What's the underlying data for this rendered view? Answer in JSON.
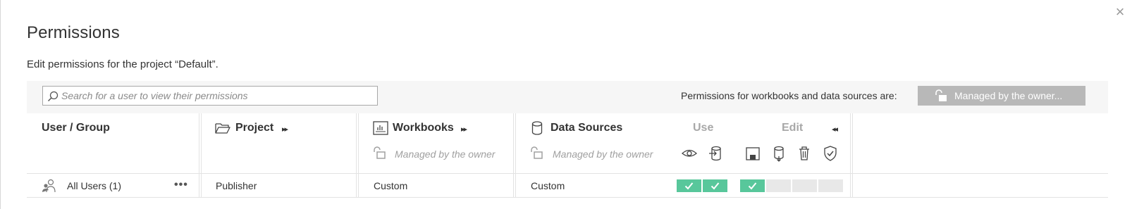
{
  "dialog": {
    "title": "Permissions",
    "subtitle": "Edit permissions for the project “Default”.",
    "close_icon": "×"
  },
  "toolbar": {
    "search_placeholder": "Search for a user to view their permissions",
    "permissions_label": "Permissions for workbooks and data sources are:",
    "managed_button_label": "Managed by the owner..."
  },
  "columns": {
    "user_group": "User / Group",
    "project": "Project",
    "workbooks": "Workbooks",
    "data_sources": "Data Sources",
    "use": "Use",
    "edit": "Edit",
    "managed_note": "Managed by the owner",
    "expand_glyph": "▸▸",
    "collapse_glyph": "◂◂"
  },
  "rows": [
    {
      "user": "All Users (1)",
      "more": "•••",
      "project": "Publisher",
      "workbooks": "Custom",
      "data_sources": "Custom",
      "use_caps": [
        true,
        true
      ],
      "edit_caps": [
        true,
        false,
        false,
        false
      ]
    }
  ],
  "icons": {
    "close": "close-icon",
    "search": "search-icon",
    "lock": "unlock-icon",
    "user_group": "user-group-icon",
    "project": "folder-icon",
    "workbooks": "workbook-icon",
    "data_sources": "database-icon",
    "use_caps": [
      "view-icon",
      "connect-icon"
    ],
    "edit_caps": [
      "save-icon",
      "download-datasource-icon",
      "delete-icon",
      "set-permissions-icon"
    ],
    "check": "check-icon"
  },
  "colors": {
    "allowed": "#58c79b",
    "unspecified": "#e8e8e8",
    "managed_button": "#b8b8b8",
    "toolbar_bg": "#f6f6f6"
  }
}
